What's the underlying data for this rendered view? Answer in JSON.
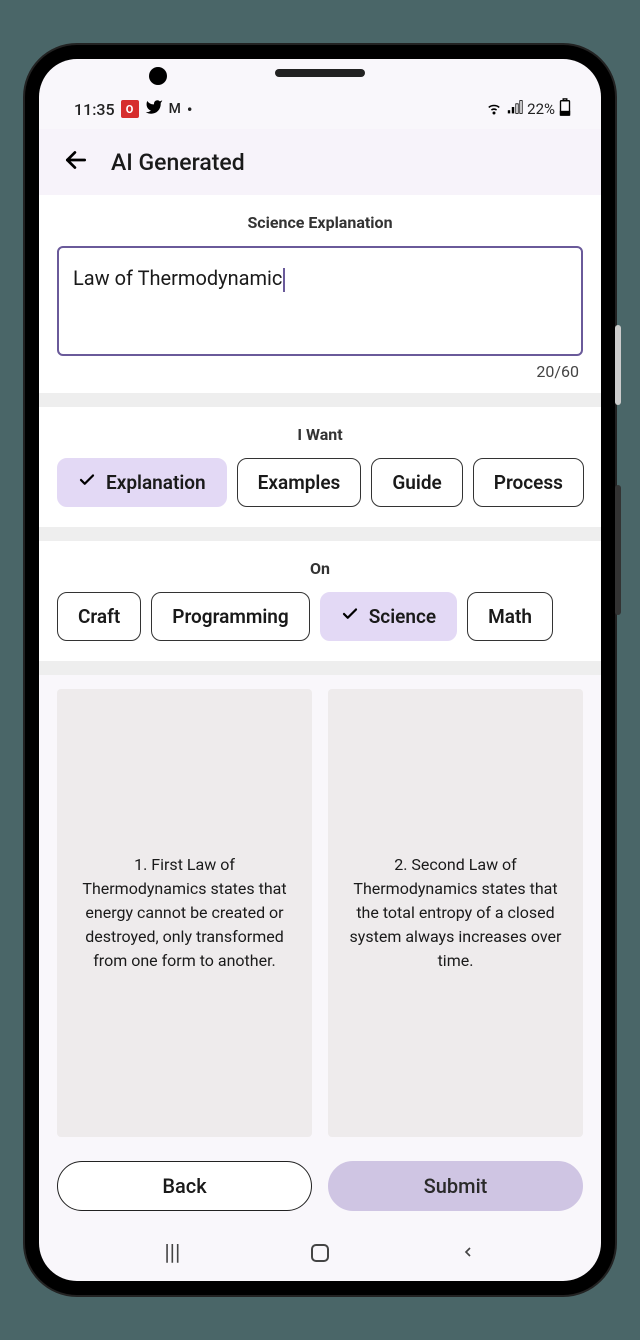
{
  "status": {
    "time": "11:35",
    "battery": "22%"
  },
  "header": {
    "title": "AI Generated"
  },
  "input_section": {
    "label": "Science Explanation",
    "value": "Law of Thermodynamic",
    "counter": "20/60"
  },
  "want_section": {
    "label": "I Want",
    "chips": [
      {
        "label": "Explanation",
        "selected": true
      },
      {
        "label": "Examples",
        "selected": false
      },
      {
        "label": "Guide",
        "selected": false
      },
      {
        "label": "Process",
        "selected": false
      }
    ]
  },
  "on_section": {
    "label": "On",
    "chips": [
      {
        "label": "Craft",
        "selected": false
      },
      {
        "label": "Programming",
        "selected": false
      },
      {
        "label": "Science",
        "selected": true
      },
      {
        "label": "Math",
        "selected": false
      }
    ]
  },
  "results": [
    "1. First Law of Thermodynamics states that energy cannot be created or destroyed, only transformed from one form to another.",
    "2. Second Law of Thermodynamics states that the total entropy of a closed system always increases over time."
  ],
  "buttons": {
    "back": "Back",
    "submit": "Submit"
  }
}
